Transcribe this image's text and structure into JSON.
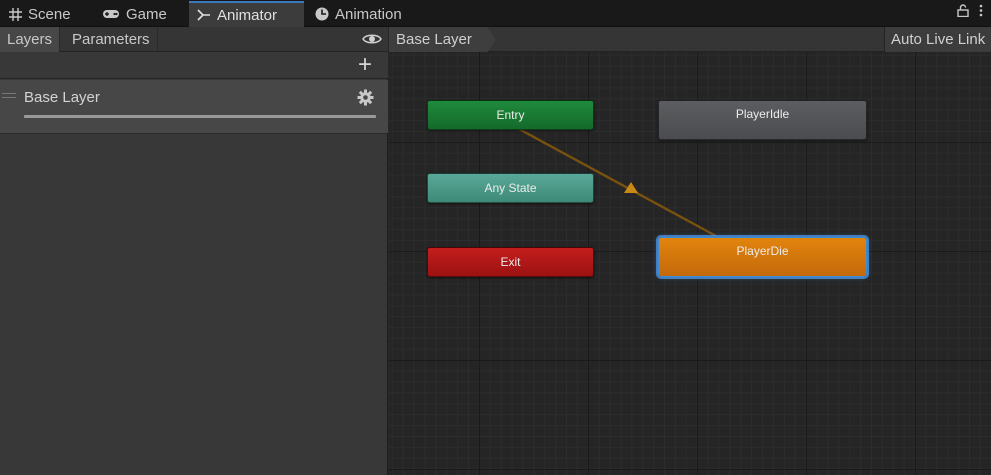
{
  "window_tabs": [
    {
      "label": "Scene",
      "icon": "grid-icon",
      "active": false
    },
    {
      "label": "Game",
      "icon": "gamepad-icon",
      "active": false
    },
    {
      "label": "Animator",
      "icon": "animator-icon",
      "active": true
    },
    {
      "label": "Animation",
      "icon": "clock-icon",
      "active": false
    }
  ],
  "window_controls": {
    "lock_icon": "lock-icon",
    "menu_icon": "kebab-menu-icon"
  },
  "left_panel": {
    "tabs": [
      {
        "label": "Layers",
        "active": true
      },
      {
        "label": "Parameters",
        "active": false
      }
    ],
    "visibility_icon": "eye-icon",
    "add_button": "+",
    "layers": [
      {
        "name": "Base Layer",
        "weight": 1.0
      }
    ]
  },
  "graph": {
    "breadcrumb": "Base Layer",
    "auto_live_link": "Auto Live Link",
    "nodes": {
      "entry": "Entry",
      "any_state": "Any State",
      "exit": "Exit",
      "player_idle": "PlayerIdle",
      "player_die": "PlayerDie"
    }
  },
  "colors": {
    "accent": "#3a79bb",
    "entry": "#1f8a3c",
    "any_state": "#5aa897",
    "exit": "#c41d1d",
    "state_default": "#5b5d60",
    "state_default_selected": "#e1840e",
    "transition": "#8a5c10"
  }
}
